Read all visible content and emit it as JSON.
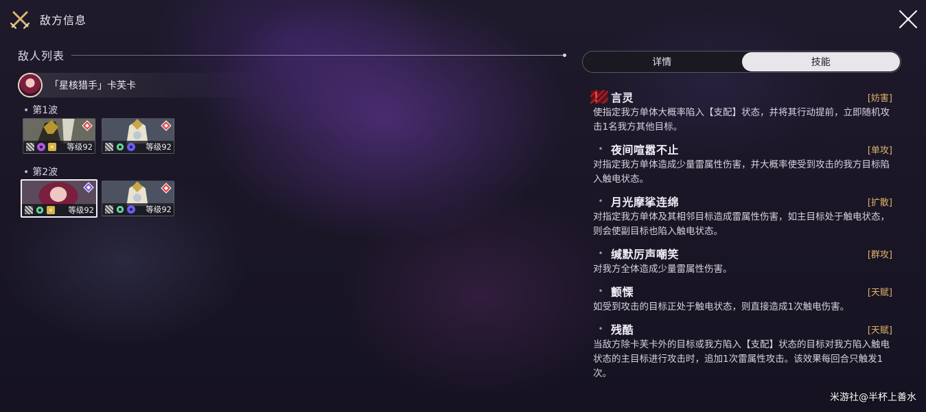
{
  "header": {
    "title": "敌方信息",
    "title_icon": "crossed-swords-icon",
    "close_icon": "close-icon"
  },
  "enemy_list": {
    "label": "敌人列表",
    "boss": {
      "name": "「星核猎手」卡芙卡"
    },
    "waves": [
      {
        "label": "第1波",
        "enemies": [
          {
            "level": "等级92",
            "weaknesses": [
              "physical",
              "imaginary",
              "lightning"
            ]
          },
          {
            "level": "等级92",
            "weaknesses": [
              "physical",
              "wind",
              "quantum"
            ]
          }
        ]
      },
      {
        "label": "第2波",
        "enemies": [
          {
            "level": "等级92",
            "weaknesses": [
              "physical",
              "wind",
              "imaginary"
            ],
            "selected": true
          },
          {
            "level": "等级92",
            "weaknesses": [
              "physical",
              "wind",
              "quantum"
            ]
          }
        ]
      }
    ]
  },
  "tabs": [
    {
      "label": "详情",
      "active": false
    },
    {
      "label": "技能",
      "active": true
    }
  ],
  "skills": [
    {
      "name": "言灵",
      "tag": "[妨害]",
      "desc": "使指定我方单体大概率陷入【支配】状态，并将其行动提前，立即随机攻击1名我方其他目标。"
    },
    {
      "name": "夜间喧嚣不止",
      "tag": "[单攻]",
      "desc": "对指定我方单体造成少量雷属性伤害，并大概率使受到攻击的我方目标陷入触电状态。"
    },
    {
      "name": "月光摩挲连绵",
      "tag": "[扩散]",
      "desc": "对指定我方单体及其相邻目标造成雷属性伤害，如主目标处于触电状态，则会使副目标也陷入触电状态。"
    },
    {
      "name": "缄默厉声嘲笑",
      "tag": "[群攻]",
      "desc": "对我方全体造成少量雷属性伤害。"
    },
    {
      "name": "颤慄",
      "tag": "[天赋]",
      "desc": "如受到攻击的目标正处于触电状态，则直接造成1次触电伤害。"
    },
    {
      "name": "残酷",
      "tag": "[天赋]",
      "desc": "当敌方除卡芙卡外的目标或我方陷入【支配】状态的目标对我方陷入触电状态的主目标进行攻击时，追加1次雷属性攻击。该效果每回合只触发1次。"
    }
  ],
  "watermark": "米游社@半杯上善水",
  "colors": {
    "tag": "#e0b46a",
    "alert": "#d8262f",
    "active_tab": "#e8e6ea"
  }
}
